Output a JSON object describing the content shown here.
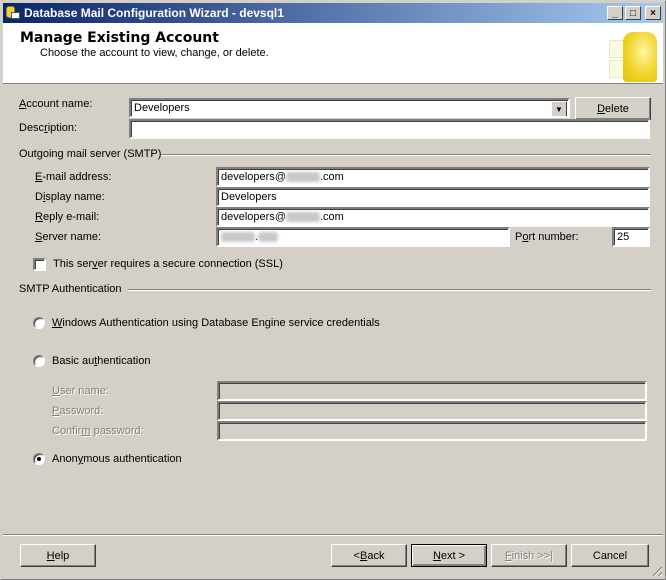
{
  "window": {
    "title": "Database Mail Configuration Wizard - devsql1",
    "minimize": "_",
    "maximize": "□",
    "close": "×"
  },
  "header": {
    "title": "Manage Existing Account",
    "subtitle": "Choose the account to view, change, or delete."
  },
  "account": {
    "name_label_u": "A",
    "name_label_rest": "ccount name:",
    "name_value": "Developers",
    "delete_u": "D",
    "delete_rest": "elete",
    "desc_label_pre": "Desc",
    "desc_label_u": "r",
    "desc_label_post": "iption:",
    "desc_value": ""
  },
  "smtp": {
    "group_label": "Outgoing mail server (SMTP)",
    "email_label_u": "E",
    "email_label_rest": "-mail address:",
    "email_prefix": "developers@",
    "email_suffix": ".com",
    "display_label_pre": "D",
    "display_label_u": "i",
    "display_label_post": "splay name:",
    "display_value": "Developers",
    "reply_label_u": "R",
    "reply_label_rest": "eply e-mail:",
    "reply_prefix": "developers@",
    "reply_suffix": ".com",
    "server_label_u": "S",
    "server_label_rest": "erver name:",
    "server_value_dot": ".",
    "port_label_pre": "P",
    "port_label_u": "o",
    "port_label_post": "rt number:",
    "port_value": "25",
    "ssl_pre": "This ser",
    "ssl_u": "v",
    "ssl_post": "er requires a secure connection (SSL)",
    "ssl_checked": false
  },
  "auth": {
    "group_label": "SMTP Authentication",
    "windows_u": "W",
    "windows_rest": "indows Authentication using Database Engine service credentials",
    "basic_pre": "Basic au",
    "basic_u": "t",
    "basic_post": "hentication",
    "user_u": "U",
    "user_rest": "ser name:",
    "password_u": "P",
    "password_rest": "assword:",
    "confirm_pre": "Confir",
    "confirm_u": "m",
    "confirm_post": " password:",
    "anon_pre": "Anon",
    "anon_u": "y",
    "anon_post": "mous authentication",
    "selected": "anonymous"
  },
  "footer": {
    "help_u": "H",
    "help_rest": "elp",
    "back_pre": "< ",
    "back_u": "B",
    "back_rest": "ack",
    "next_u": "N",
    "next_rest": "ext >",
    "finish_u": "F",
    "finish_rest": "inish >>|",
    "cancel": "Cancel"
  }
}
